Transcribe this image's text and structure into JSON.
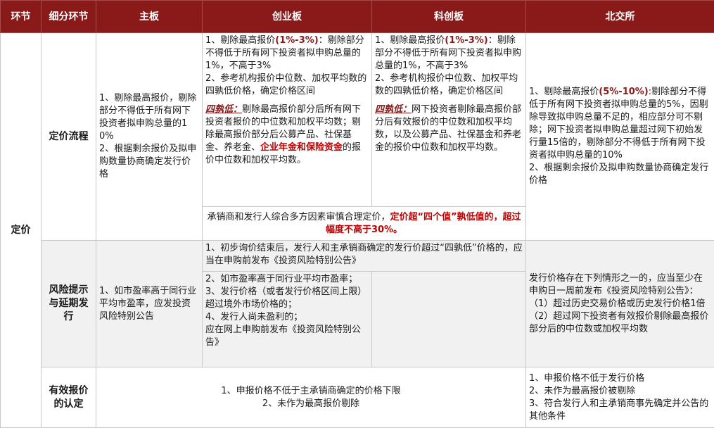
{
  "header": {
    "stage": "环节",
    "sub_stage": "细分环节",
    "main_board": "主板",
    "chinext": "创业板",
    "star": "科创板",
    "bse": "北交所"
  },
  "stage_pricing": "定价",
  "pricing_process": {
    "label": "定价流程",
    "main_board": {
      "l1": "1、剔除最高报价，剔除部分不得低于所有网下投资者拟申购总量的10%",
      "l2": "2、根据剩余报价及拟申购数量协商确定发行价格"
    },
    "chinext": {
      "l1_pre": "1、剔除最高报价",
      "l1_pct": "(1%-3%)",
      "l1_post": "：剔除部分不得低于所有网下投资者拟申购总量的1%，不高于3%",
      "l2": "2、参考机构报价中位数、加权平均数的四孰低价格，确定价格区间",
      "tag": "四孰低：",
      "body_pre": "剔除最高报价部分后所有网下投资者报价的中位数和加权平均数；剔除最高报价部分后公募产品、社保基金、养老金、",
      "body_red": "企业年金和保险资金",
      "body_post": "的报价中位数和加权平均数。"
    },
    "star": {
      "l1_pre": "1、剔除最高报价",
      "l1_pct": "(1%-3%)",
      "l1_post": "：剔除部分不得低于所有网下投资者拟申购总量的1%，不高于3%",
      "l2": "2、参考机构报价中位数、加权平均数的四孰低价格，确定价格区间",
      "tag": "四孰低：",
      "body": "网下投资者剔除最高报价部分后有效报价的中位数和加权平均数，以及公募产品、社保基金和养老金的报价中位数和加权平均数。"
    },
    "shared_note": {
      "pre": "承销商和发行人综合多方因素审慎合理定价，",
      "red": "定价超“四个值”孰低值的，超过幅度不高于30%。"
    },
    "bse": {
      "l1_pre": "1、剔除最高报价",
      "l1_pct": "(5%-10%)",
      "l1_post": ":剔除部分不得低于所有网下投资者拟申购总量的5%，因剔除导致拟申购总量不足的，相应部分可不剔除；网下投资者拟申购总量超过网下初始发行量15倍的，剔除部分不得低于所有网下投资者拟申购总量的10%",
      "l2": "2、根据剩余报价及拟申购数量协商确定发行价格"
    }
  },
  "risk": {
    "label": "风险提示与延期发行",
    "main_board": "1、如市盈率高于同行业平均市盈率，应发投资风险特别公告",
    "chinext_star_l1": "1、初步询价结束后，发行人和主承销商确定的发行价超过“四孰低”价格的，应当在申购前发布《投资风险特别公告》",
    "chinext": {
      "l2": "2、如市盈率高于同行业平均市盈率；",
      "l3": "3、发行价格（或者发行价格区间上限）超过境外市场价格的；",
      "l4": "4、发行人尚未盈利的；",
      "l5": "应在网上申购前发布《投资风险特别公告》"
    },
    "bse": {
      "intro": "发行价格存在下列情形之一的，应当至少在申购日一周前发布《投资风险特别公告》：",
      "c1": "（1）超过历史交易价格或历史发行价格1倍",
      "c2": "（2）超过网下投资者有效报价剔除最高报价部分后的中位数或加权平均数"
    }
  },
  "valid_quote": {
    "label": "有效报价的认定",
    "shared_l1": "1、申报价格不低于主承销商确定的价格下限",
    "shared_l2": "2、未作为最高报价剔除",
    "bse": {
      "l1": "1、申报价格不低于发行价格",
      "l2": "2、未作为最高报价被剔除",
      "l3": "3、符合发行人和主承销商事先确定并公告的其他条件"
    }
  }
}
